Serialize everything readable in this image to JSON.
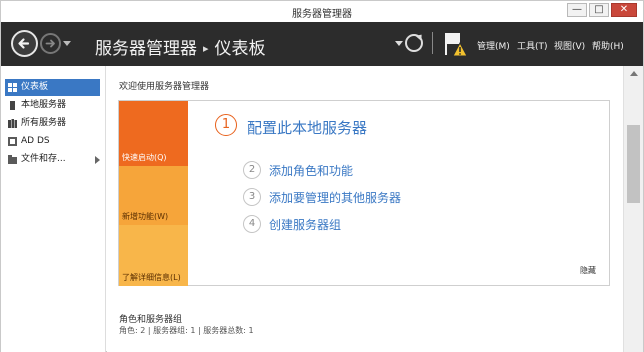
{
  "window": {
    "title": "服务器管理器",
    "minimize_symbol": "—",
    "maximize_symbol": "□",
    "close_symbol": "✕"
  },
  "header": {
    "breadcrumb_root": "服务器管理器",
    "breadcrumb_separator": "▸",
    "breadcrumb_current": "仪表板",
    "menus": {
      "manage": "管理(M)",
      "tools": "工具(T)",
      "view": "视图(V)",
      "help": "帮助(H)"
    },
    "notification_icon": "flag-warning-icon"
  },
  "sidebar": {
    "items": [
      {
        "label": "仪表板",
        "icon": "dashboard-icon",
        "active": true
      },
      {
        "label": "本地服务器",
        "icon": "server-icon",
        "active": false
      },
      {
        "label": "所有服务器",
        "icon": "servers-icon",
        "active": false
      },
      {
        "label": "AD DS",
        "icon": "ad-ds-icon",
        "active": false
      },
      {
        "label": "文件和存...",
        "icon": "file-storage-icon",
        "active": false
      }
    ]
  },
  "main": {
    "welcome_title": "欢迎使用服务器管理器",
    "tiles": {
      "quick_start": "快速启动(Q)",
      "whats_new": "新增功能(W)",
      "learn_more": "了解详细信息(L)"
    },
    "steps": [
      {
        "number": "1",
        "label": "配置此本地服务器"
      },
      {
        "number": "2",
        "label": "添加角色和功能"
      },
      {
        "number": "3",
        "label": "添加要管理的其他服务器"
      },
      {
        "number": "4",
        "label": "创建服务器组"
      }
    ],
    "hide_label": "隐藏",
    "roles_title": "角色和服务器组",
    "roles_summary": "角色: 2 | 服务器组: 1 | 服务器总数: 1"
  },
  "colors": {
    "header_bg": "#2c2c2c",
    "accent_orange": "#ee6a1f",
    "tile_amber": "#f6a53a",
    "link_blue": "#3a78c4",
    "selected_bg": "#3a78c4",
    "close_button": "#c9473a"
  }
}
